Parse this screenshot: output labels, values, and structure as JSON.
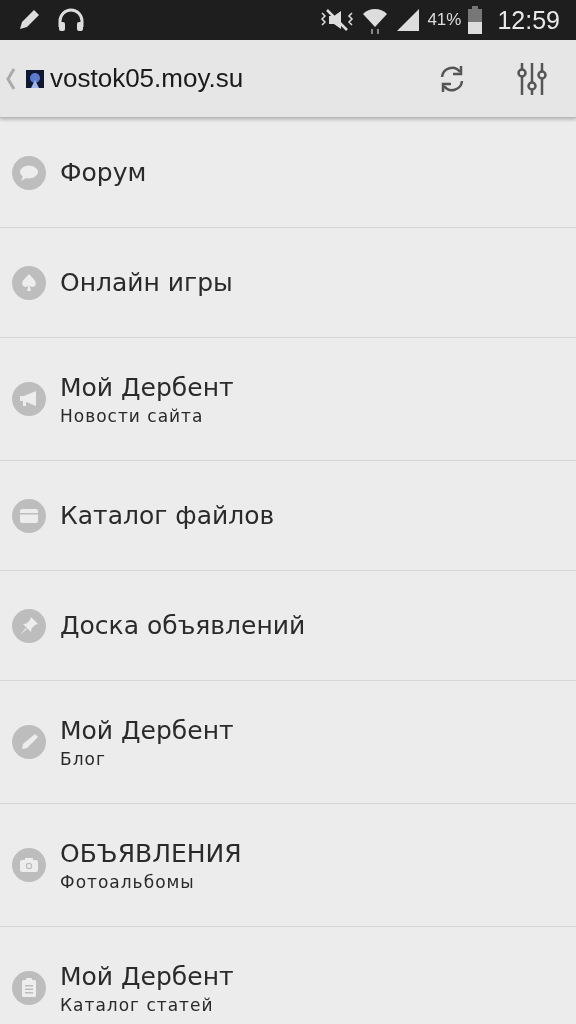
{
  "status_bar": {
    "battery_percent": "41%",
    "time": "12:59"
  },
  "toolbar": {
    "title": "vostok05.moy.su"
  },
  "items": [
    {
      "kind": "forum",
      "title": "Форум"
    },
    {
      "kind": "games",
      "title": "Онлайн игры"
    },
    {
      "kind": "news",
      "title": "Мой Дербент",
      "subtitle": "Новости сайта"
    },
    {
      "kind": "files",
      "title": "Каталог файлов"
    },
    {
      "kind": "board",
      "title": "Доска объявлений"
    },
    {
      "kind": "blog",
      "title": "Мой Дербент",
      "subtitle": "Блог"
    },
    {
      "kind": "photos",
      "title": "ОБЪЯВЛЕНИЯ",
      "subtitle": "Фотоальбомы"
    },
    {
      "kind": "articles",
      "title": "Мой Дербент",
      "subtitle": "Каталог статей"
    }
  ]
}
